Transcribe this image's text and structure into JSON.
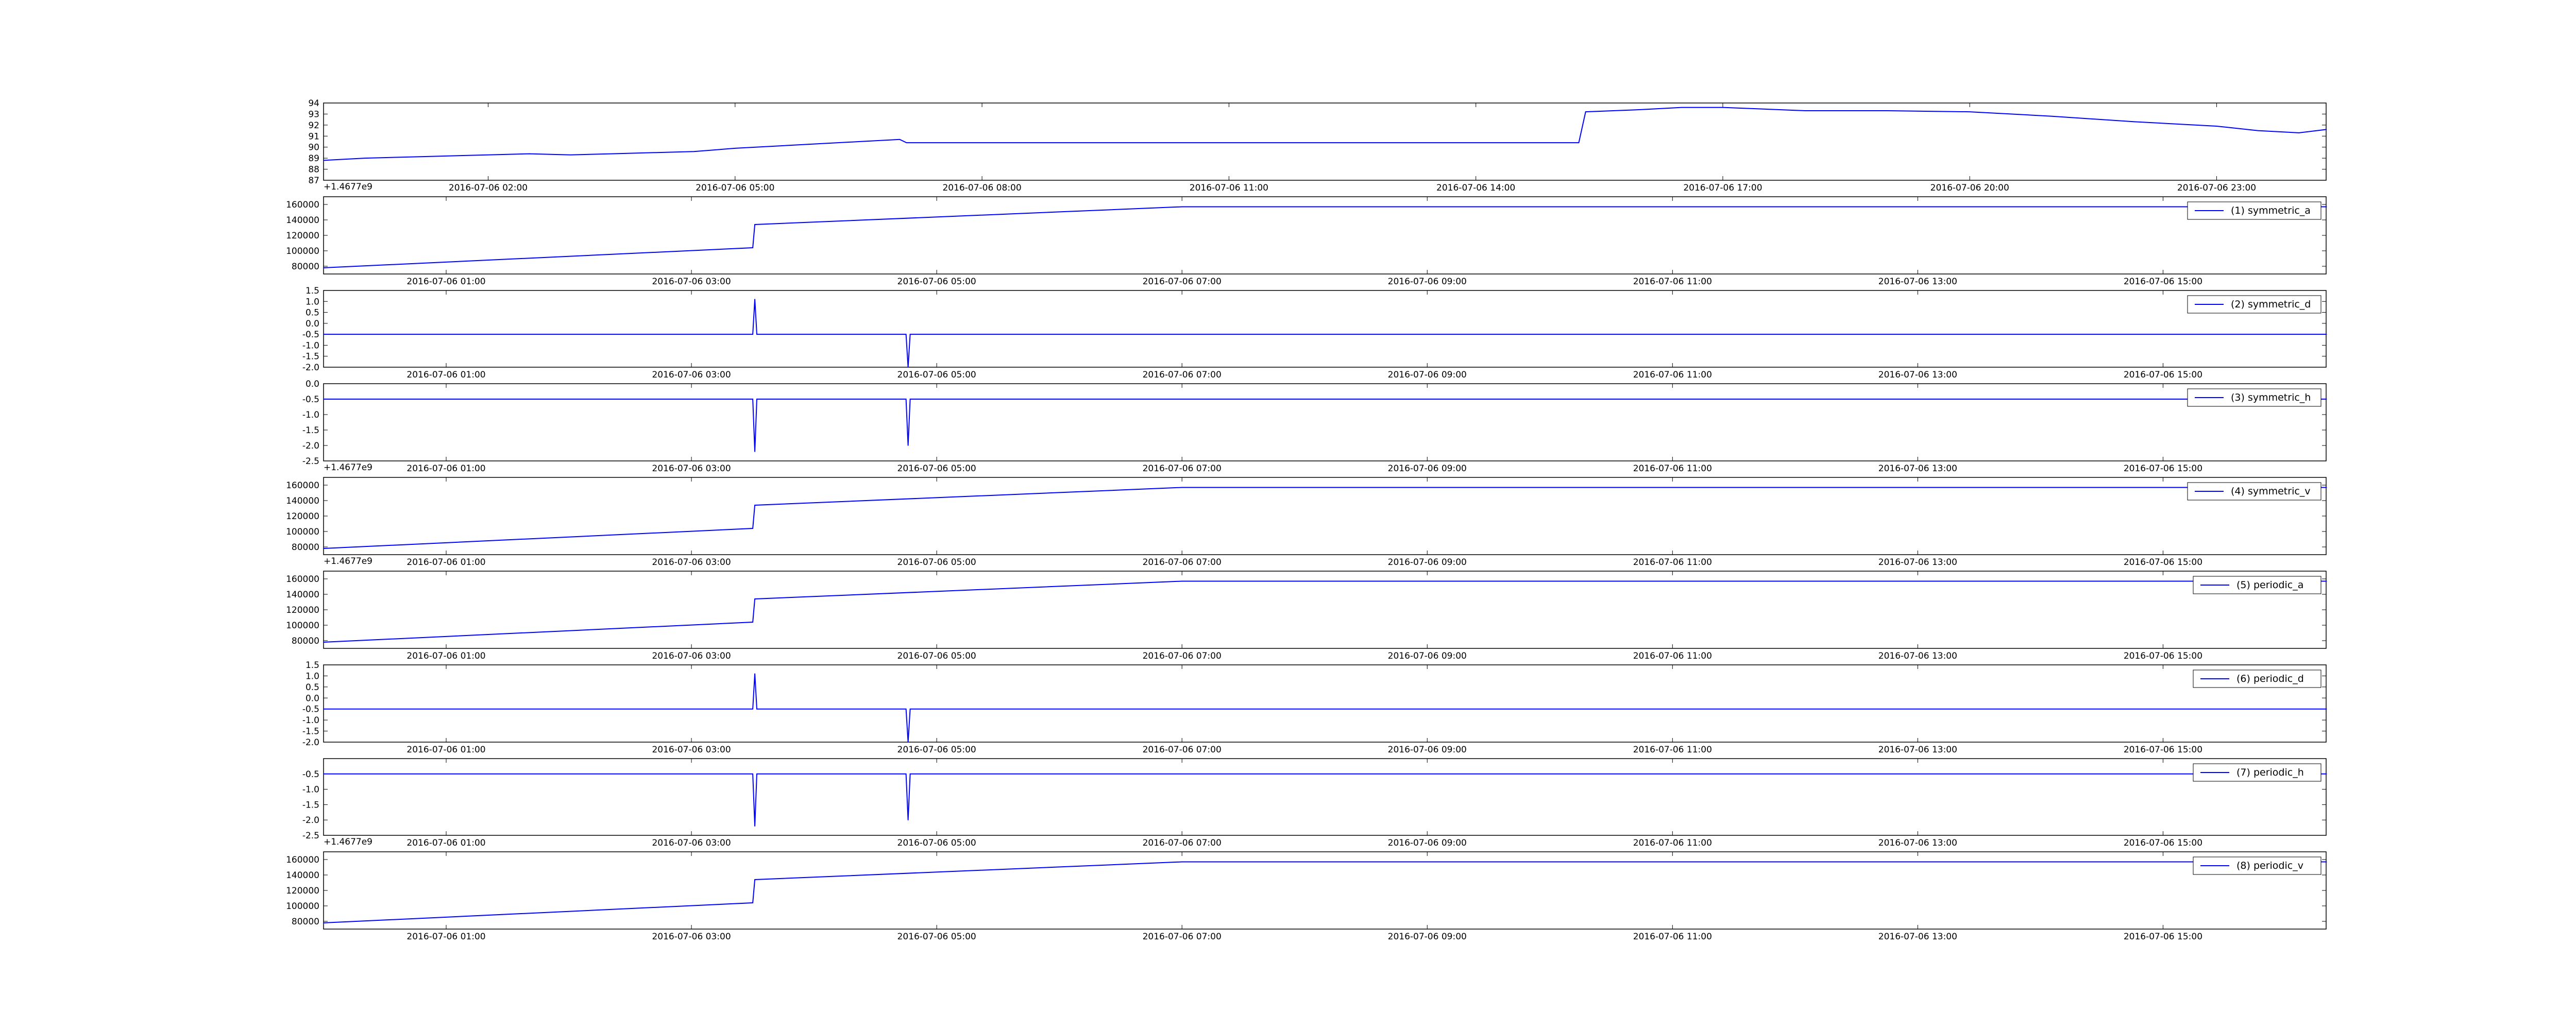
{
  "figure": {
    "background": "#ffffff",
    "line_color": "#0000ff"
  },
  "chart_data": [
    {
      "type": "line",
      "title": "",
      "xlabel": "",
      "ylabel": "",
      "grid": false,
      "legend": null,
      "ylim": [
        87,
        94
      ],
      "yticks": [
        "94",
        "93",
        "92",
        "91",
        "90",
        "89",
        "88",
        "87"
      ],
      "xticks": [
        "2016-07-06 02:00",
        "2016-07-06 05:00",
        "2016-07-06 08:00",
        "2016-07-06 11:00",
        "2016-07-06 14:00",
        "2016-07-06 17:00",
        "2016-07-06 20:00",
        "2016-07-06 23:00"
      ],
      "offset_text": "+1.4677e9",
      "x": [
        "2016-07-06 00:00",
        "2016-07-06 00:30",
        "2016-07-06 01:00",
        "2016-07-06 01:30",
        "2016-07-06 02:00",
        "2016-07-06 02:30",
        "2016-07-06 03:00",
        "2016-07-06 03:30",
        "2016-07-06 04:00",
        "2016-07-06 04:30",
        "2016-07-06 05:00",
        "2016-07-06 05:30",
        "2016-07-06 06:00",
        "2016-07-06 06:30",
        "2016-07-06 07:00",
        "2016-07-06 07:05",
        "2016-07-06 15:15",
        "2016-07-06 15:20",
        "2016-07-06 16:00",
        "2016-07-06 16:30",
        "2016-07-06 17:00",
        "2016-07-06 18:00",
        "2016-07-06 19:00",
        "2016-07-06 20:00",
        "2016-07-06 20:30",
        "2016-07-06 21:00",
        "2016-07-06 22:00",
        "2016-07-06 23:00",
        "2016-07-06 23:30",
        "2016-07-07 00:00",
        "2016-07-07 00:20"
      ],
      "series": [
        {
          "values": [
            88.8,
            89.0,
            89.1,
            89.2,
            89.3,
            89.4,
            89.3,
            89.4,
            89.5,
            89.6,
            89.9,
            90.1,
            90.3,
            90.5,
            90.7,
            90.4,
            90.4,
            93.2,
            93.4,
            93.6,
            93.6,
            93.3,
            93.3,
            93.2,
            93.0,
            92.8,
            92.3,
            91.9,
            91.5,
            91.3,
            91.6
          ]
        }
      ]
    },
    {
      "type": "line",
      "title": "",
      "xlabel": "",
      "ylabel": "",
      "grid": false,
      "legend": "top-right",
      "ylim": [
        70000,
        170000
      ],
      "yticks": [
        "160000",
        "140000",
        "120000",
        "100000",
        "80000"
      ],
      "xticks": [
        "2016-07-06 01:00",
        "2016-07-06 03:00",
        "2016-07-06 05:00",
        "2016-07-06 07:00",
        "2016-07-06 09:00",
        "2016-07-06 11:00",
        "2016-07-06 13:00",
        "2016-07-06 15:00"
      ],
      "offset_text": "",
      "x": [
        "2016-07-06 00:00",
        "2016-07-06 03:30",
        "2016-07-06 03:31",
        "2016-07-06 07:00",
        "2016-07-06 16:20"
      ],
      "series": [
        {
          "name": "(1) symmetric_a",
          "values": [
            78000,
            104000,
            134000,
            157000,
            157000
          ]
        }
      ]
    },
    {
      "type": "line",
      "title": "",
      "xlabel": "",
      "ylabel": "",
      "grid": false,
      "legend": "top-right",
      "ylim": [
        -2.0,
        1.5
      ],
      "yticks": [
        "1.5",
        "1.0",
        "0.5",
        "0.0",
        "-0.5",
        "-1.0",
        "-1.5",
        "-2.0"
      ],
      "xticks": [
        "2016-07-06 01:00",
        "2016-07-06 03:00",
        "2016-07-06 05:00",
        "2016-07-06 07:00",
        "2016-07-06 09:00",
        "2016-07-06 11:00",
        "2016-07-06 13:00",
        "2016-07-06 15:00"
      ],
      "offset_text": "",
      "x": [
        "2016-07-06 00:00",
        "2016-07-06 03:30",
        "2016-07-06 03:31",
        "2016-07-06 03:32",
        "2016-07-06 04:45",
        "2016-07-06 04:46",
        "2016-07-06 04:47",
        "2016-07-06 16:20"
      ],
      "series": [
        {
          "name": "(2) symmetric_d",
          "values": [
            -0.5,
            -0.5,
            1.1,
            -0.5,
            -0.5,
            -2.0,
            -0.5,
            -0.5
          ]
        }
      ]
    },
    {
      "type": "line",
      "title": "",
      "xlabel": "",
      "ylabel": "",
      "grid": false,
      "legend": "top-right",
      "ylim": [
        -2.5,
        0.0
      ],
      "yticks": [
        "0.0",
        "-0.5",
        "-1.0",
        "-1.5",
        "-2.0",
        "-2.5"
      ],
      "xticks": [
        "2016-07-06 01:00",
        "2016-07-06 03:00",
        "2016-07-06 05:00",
        "2016-07-06 07:00",
        "2016-07-06 09:00",
        "2016-07-06 11:00",
        "2016-07-06 13:00",
        "2016-07-06 15:00"
      ],
      "offset_text": "+1.4677e9",
      "x": [
        "2016-07-06 00:00",
        "2016-07-06 03:30",
        "2016-07-06 03:31",
        "2016-07-06 03:32",
        "2016-07-06 04:45",
        "2016-07-06 04:46",
        "2016-07-06 04:47",
        "2016-07-06 16:20"
      ],
      "series": [
        {
          "name": "(3) symmetric_h",
          "values": [
            -0.5,
            -0.5,
            -2.2,
            -0.5,
            -0.5,
            -2.0,
            -0.5,
            -0.5
          ]
        }
      ]
    },
    {
      "type": "line",
      "title": "",
      "xlabel": "",
      "ylabel": "",
      "grid": false,
      "legend": "top-right",
      "ylim": [
        70000,
        170000
      ],
      "yticks": [
        "160000",
        "140000",
        "120000",
        "100000",
        "80000"
      ],
      "xticks": [
        "2016-07-06 01:00",
        "2016-07-06 03:00",
        "2016-07-06 05:00",
        "2016-07-06 07:00",
        "2016-07-06 09:00",
        "2016-07-06 11:00",
        "2016-07-06 13:00",
        "2016-07-06 15:00"
      ],
      "offset_text": "+1.4677e9",
      "x": [
        "2016-07-06 00:00",
        "2016-07-06 03:30",
        "2016-07-06 03:31",
        "2016-07-06 07:00",
        "2016-07-06 16:20"
      ],
      "series": [
        {
          "name": "(4) symmetric_v",
          "values": [
            78000,
            104000,
            134000,
            157000,
            157000
          ]
        }
      ]
    },
    {
      "type": "line",
      "title": "",
      "xlabel": "",
      "ylabel": "",
      "grid": false,
      "legend": "top-right",
      "ylim": [
        70000,
        170000
      ],
      "yticks": [
        "160000",
        "140000",
        "120000",
        "100000",
        "80000"
      ],
      "xticks": [
        "2016-07-06 01:00",
        "2016-07-06 03:00",
        "2016-07-06 05:00",
        "2016-07-06 07:00",
        "2016-07-06 09:00",
        "2016-07-06 11:00",
        "2016-07-06 13:00",
        "2016-07-06 15:00"
      ],
      "offset_text": "",
      "x": [
        "2016-07-06 00:00",
        "2016-07-06 03:30",
        "2016-07-06 03:31",
        "2016-07-06 07:00",
        "2016-07-06 16:20"
      ],
      "series": [
        {
          "name": "(5) periodic_a",
          "values": [
            78000,
            104000,
            134000,
            157000,
            157000
          ]
        }
      ]
    },
    {
      "type": "line",
      "title": "",
      "xlabel": "",
      "ylabel": "",
      "grid": false,
      "legend": "top-right",
      "ylim": [
        -2.0,
        1.5
      ],
      "yticks": [
        "1.5",
        "1.0",
        "0.5",
        "0.0",
        "-0.5",
        "-1.0",
        "-1.5",
        "-2.0"
      ],
      "xticks": [
        "2016-07-06 01:00",
        "2016-07-06 03:00",
        "2016-07-06 05:00",
        "2016-07-06 07:00",
        "2016-07-06 09:00",
        "2016-07-06 11:00",
        "2016-07-06 13:00",
        "2016-07-06 15:00"
      ],
      "offset_text": "",
      "x": [
        "2016-07-06 00:00",
        "2016-07-06 03:30",
        "2016-07-06 03:31",
        "2016-07-06 03:32",
        "2016-07-06 04:45",
        "2016-07-06 04:46",
        "2016-07-06 04:47",
        "2016-07-06 16:20"
      ],
      "series": [
        {
          "name": "(6) periodic_d",
          "values": [
            -0.5,
            -0.5,
            1.1,
            -0.5,
            -0.5,
            -2.0,
            -0.5,
            -0.5
          ]
        }
      ]
    },
    {
      "type": "line",
      "title": "",
      "xlabel": "",
      "ylabel": "",
      "grid": false,
      "legend": "top-right",
      "ylim": [
        -2.5,
        0.0
      ],
      "yticks": [
        "-0.5",
        "-1.0",
        "-1.5",
        "-2.0",
        "-2.5"
      ],
      "xticks": [
        "2016-07-06 01:00",
        "2016-07-06 03:00",
        "2016-07-06 05:00",
        "2016-07-06 07:00",
        "2016-07-06 09:00",
        "2016-07-06 11:00",
        "2016-07-06 13:00",
        "2016-07-06 15:00"
      ],
      "offset_text": "+1.4677e9",
      "x": [
        "2016-07-06 00:00",
        "2016-07-06 03:30",
        "2016-07-06 03:31",
        "2016-07-06 03:32",
        "2016-07-06 04:45",
        "2016-07-06 04:46",
        "2016-07-06 04:47",
        "2016-07-06 16:20"
      ],
      "series": [
        {
          "name": "(7) periodic_h",
          "values": [
            -0.5,
            -0.5,
            -2.2,
            -0.5,
            -0.5,
            -2.0,
            -0.5,
            -0.5
          ]
        }
      ]
    },
    {
      "type": "line",
      "title": "",
      "xlabel": "",
      "ylabel": "",
      "grid": false,
      "legend": "top-right",
      "ylim": [
        70000,
        170000
      ],
      "yticks": [
        "160000",
        "140000",
        "120000",
        "100000",
        "80000"
      ],
      "xticks": [
        "2016-07-06 01:00",
        "2016-07-06 03:00",
        "2016-07-06 05:00",
        "2016-07-06 07:00",
        "2016-07-06 09:00",
        "2016-07-06 11:00",
        "2016-07-06 13:00",
        "2016-07-06 15:00"
      ],
      "offset_text": "",
      "x": [
        "2016-07-06 00:00",
        "2016-07-06 03:30",
        "2016-07-06 03:31",
        "2016-07-06 07:00",
        "2016-07-06 16:20"
      ],
      "series": [
        {
          "name": "(8) periodic_v",
          "values": [
            78000,
            104000,
            134000,
            157000,
            157000
          ]
        }
      ]
    }
  ]
}
